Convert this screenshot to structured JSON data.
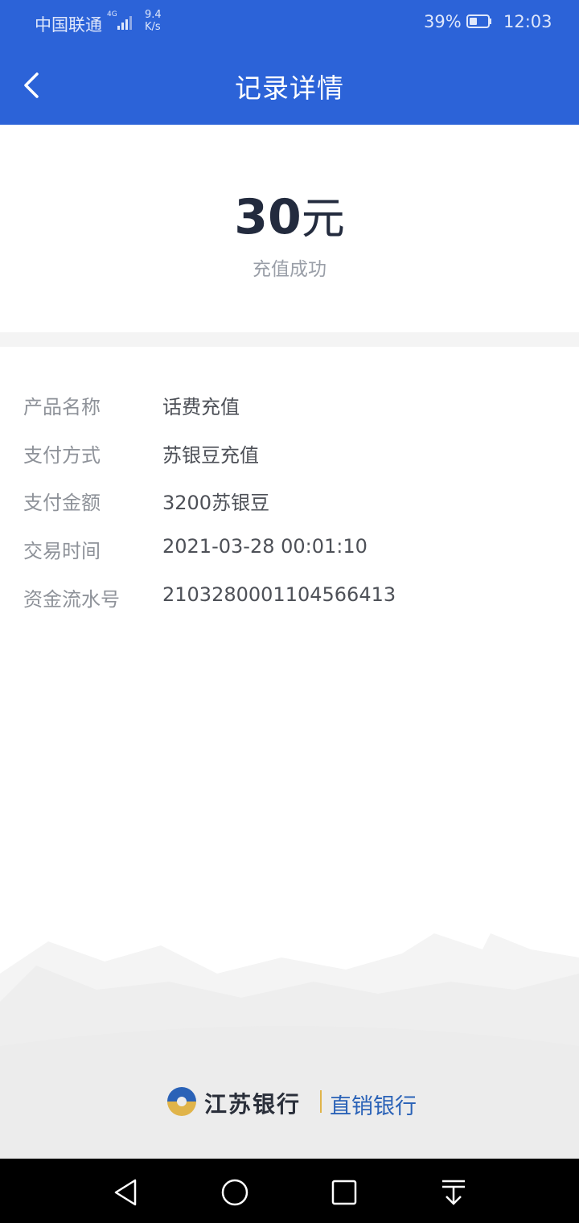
{
  "status_bar": {
    "carrier": "中国联通",
    "network_type": "4G",
    "speed_value": "9.4",
    "speed_unit": "K/s",
    "battery_percent": "39%",
    "time": "12:03"
  },
  "nav": {
    "title": "记录详情",
    "back_icon": "chevron-left-icon"
  },
  "summary": {
    "amount": "30",
    "unit": "元",
    "status": "充值成功"
  },
  "details": [
    {
      "label": "产品名称",
      "value": "话费充值"
    },
    {
      "label": "支付方式",
      "value": "苏银豆充值"
    },
    {
      "label": "支付金额",
      "value": "3200苏银豆"
    },
    {
      "label": "交易时间",
      "value": "2021-03-28 00:01:10"
    },
    {
      "label": "资金流水号",
      "value": "210328000110456641​3"
    }
  ],
  "brand": {
    "name": "江苏银行",
    "subtitle": "直销银行"
  },
  "colors": {
    "primary": "#2c63d8",
    "amount_text": "#232b3e",
    "label_text": "#8e9299",
    "value_text": "#4d5057",
    "brand_blue": "#2a62b7",
    "brand_gold": "#e0b44a"
  },
  "system_nav": [
    "back-triangle-icon",
    "home-circle-icon",
    "recents-square-icon",
    "notification-pulldown-icon"
  ]
}
